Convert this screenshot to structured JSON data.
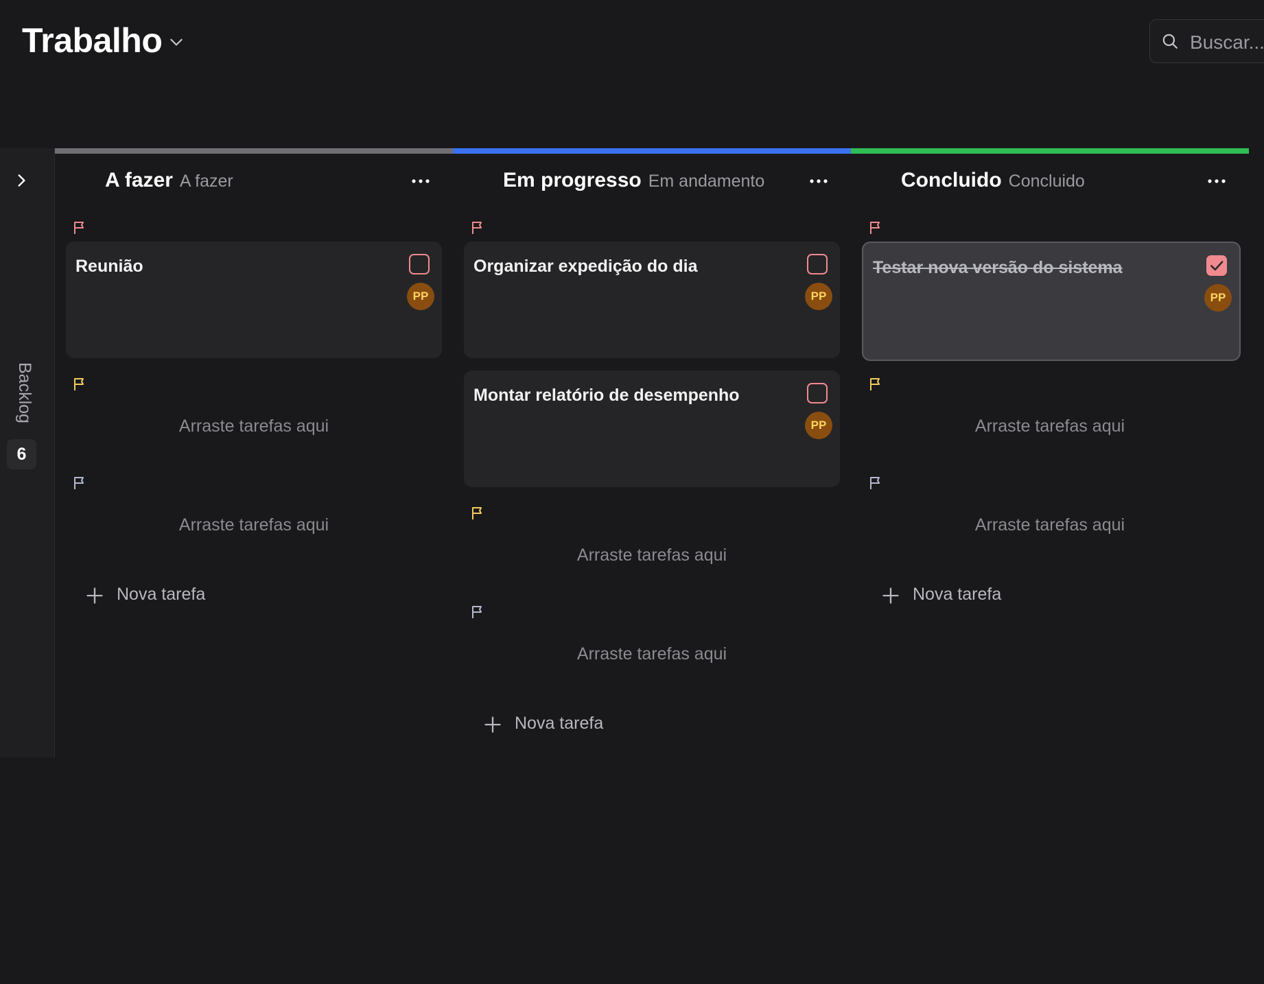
{
  "header": {
    "title": "Trabalho",
    "search_placeholder": "Buscar..."
  },
  "backlog": {
    "label": "Backlog",
    "count": "6"
  },
  "columns": [
    {
      "name": "A fazer",
      "subtitle": "A fazer",
      "color": "#6e6e73",
      "cards": [
        {
          "title": "Reunião",
          "assignee": "PP",
          "done": false
        }
      ],
      "dropzones": [
        "Arraste tarefas aqui",
        "Arraste tarefas aqui"
      ],
      "new_task_label": "Nova tarefa"
    },
    {
      "name": "Em progresso",
      "subtitle": "Em andamento",
      "color": "#3b72f0",
      "cards": [
        {
          "title": "Organizar expedição do dia",
          "assignee": "PP",
          "done": false
        },
        {
          "title": "Montar relatório de desempenho",
          "assignee": "PP",
          "done": false
        }
      ],
      "dropzones": [
        "Arraste tarefas aqui",
        "Arraste tarefas aqui"
      ],
      "new_task_label": "Nova tarefa"
    },
    {
      "name": "Concluido",
      "subtitle": "Concluido",
      "color": "#2fbd55",
      "cards": [
        {
          "title": "Testar nova versão do sistema",
          "assignee": "PP",
          "done": true
        }
      ],
      "dropzones": [
        "Arraste tarefas aqui",
        "Arraste tarefas aqui"
      ],
      "new_task_label": "Nova tarefa"
    }
  ],
  "priority_colors": {
    "high": "#f08a8f",
    "medium": "#f2cc5d",
    "low": "#b4b9d0"
  },
  "icons": [
    "chevron-down-icon",
    "search-icon",
    "chevron-right-icon",
    "more-icon",
    "flag-icon",
    "plus-icon",
    "check-icon"
  ]
}
